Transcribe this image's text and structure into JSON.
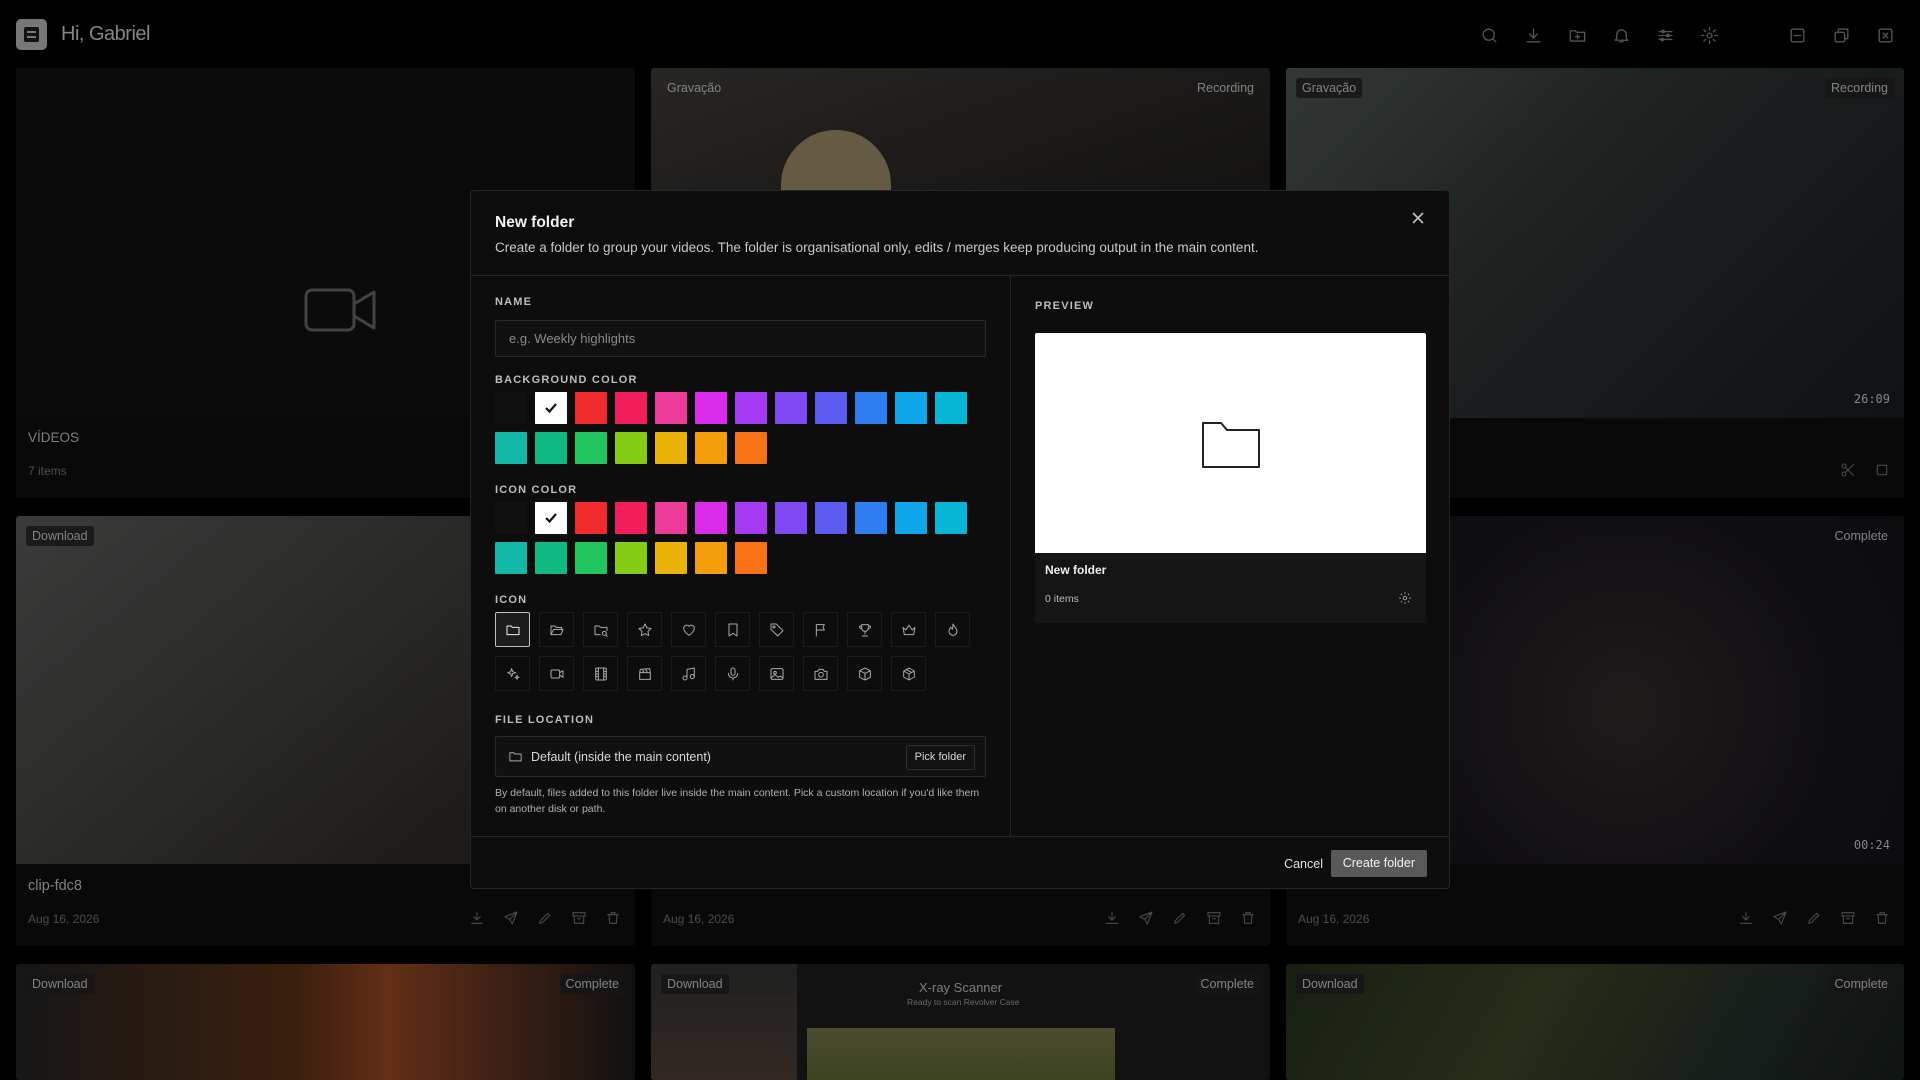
{
  "header": {
    "greeting": "Hi, Gabriel"
  },
  "cards": {
    "videos_folder": {
      "title": "VÍDEOS",
      "count": "7 items"
    },
    "top_mid": {
      "tag_left": "Gravação",
      "tag_right": "Recording"
    },
    "top_right": {
      "tag_left": "Gravação",
      "tag_right": "Recording",
      "timer": "26:09"
    },
    "mid_left": {
      "tag": "Download",
      "title": "clip-fdc8",
      "date": "Aug 16, 2026"
    },
    "mid_mid": {
      "date": "Aug 16, 2026"
    },
    "mid_right": {
      "tag": "Complete",
      "duration": "00:24",
      "date": "Aug 16, 2026"
    },
    "bot_left": {
      "tag_left": "Download",
      "tag_right": "Complete"
    },
    "bot_mid": {
      "tag_left": "Download",
      "tag_right": "Complete",
      "overlay_title": "X-ray Scanner",
      "overlay_sub": "Ready to scan Revolver Case"
    },
    "bot_right": {
      "tag_left": "Download",
      "tag_right": "Complete"
    }
  },
  "modal": {
    "title": "New folder",
    "subtitle": "Create a folder to group your videos. The folder is organisational only, edits / merges keep producing output in the main content.",
    "name_label": "NAME",
    "name_placeholder": "e.g. Weekly highlights",
    "bg_label": "BACKGROUND COLOR",
    "icon_color_label": "ICON COLOR",
    "icon_label": "ICON",
    "file_location_label": "FILE LOCATION",
    "location_value": "Default (inside the main content)",
    "pick_label": "Pick folder",
    "help_text": "By default, files added to this folder live inside the main content. Pick a custom location if you'd like them on another disk or path.",
    "preview_label": "PREVIEW",
    "preview_name": "New folder",
    "preview_count": "0 items",
    "cancel_label": "Cancel",
    "create_label": "Create folder"
  },
  "colors": [
    "#111111",
    "#ffffff",
    "#ef2b2b",
    "#f21d5b",
    "#ec3b98",
    "#da2bea",
    "#a43bf2",
    "#7f4af4",
    "#5b5bf0",
    "#2f7cf0",
    "#0ea5e9",
    "#06b6d4",
    "#14b8a6",
    "#10b981",
    "#22c55e",
    "#84cc16",
    "#eab308",
    "#f59e0b",
    "#f97316"
  ],
  "icons": [
    "folder-icon",
    "folder-open-icon",
    "folder-search-icon",
    "star-icon",
    "heart-icon",
    "bookmark-icon",
    "tag-icon",
    "flag-icon",
    "trophy-icon",
    "crown-icon",
    "flame-icon",
    "sparkles-icon",
    "video-icon",
    "film-icon",
    "clapperboard-icon",
    "music-icon",
    "mic-icon",
    "image-icon",
    "camera-icon",
    "box-icon",
    "package-icon"
  ]
}
